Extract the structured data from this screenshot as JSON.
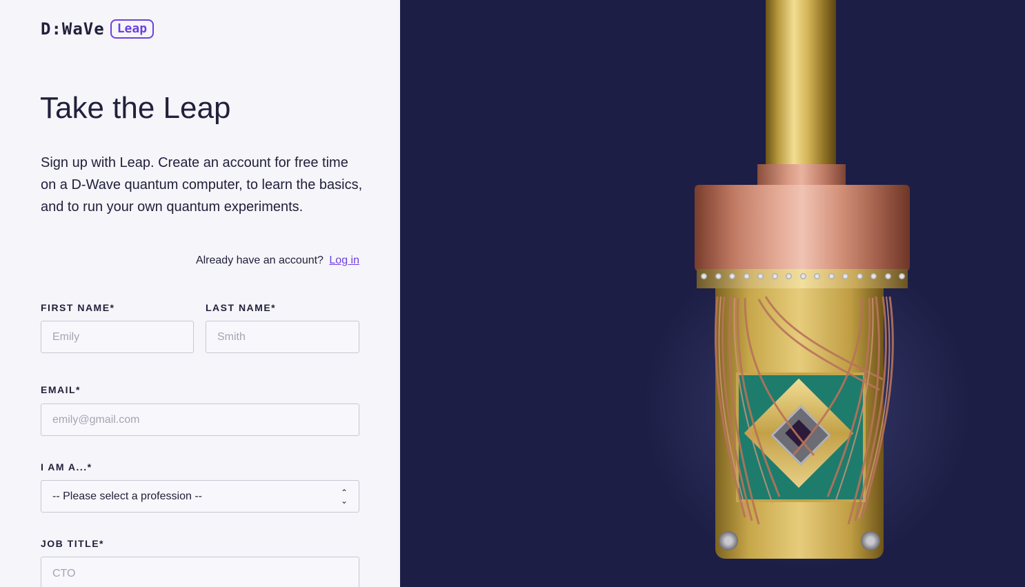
{
  "brand": {
    "wordmark": "D:WaVe",
    "product": "Leap",
    "accent_color": "#6e3fe0"
  },
  "heading": "Take the Leap",
  "intro": "Sign up with Leap. Create an account for free time on a D-Wave quantum computer, to learn the basics, and to run your own quantum experiments.",
  "login": {
    "prompt": "Already have an account?",
    "link_label": "Log in"
  },
  "form": {
    "first_name": {
      "label": "FIRST NAME*",
      "placeholder": "Emily"
    },
    "last_name": {
      "label": "LAST NAME*",
      "placeholder": "Smith"
    },
    "email": {
      "label": "EMAIL*",
      "placeholder": "emily@gmail.com"
    },
    "profession": {
      "label": "I AM A...*",
      "selected": "-- Please select a profession --"
    },
    "job_title": {
      "label": "JOB TITLE*",
      "placeholder": "CTO"
    }
  },
  "hero_image": {
    "icon": "quantum-processor-photo"
  }
}
